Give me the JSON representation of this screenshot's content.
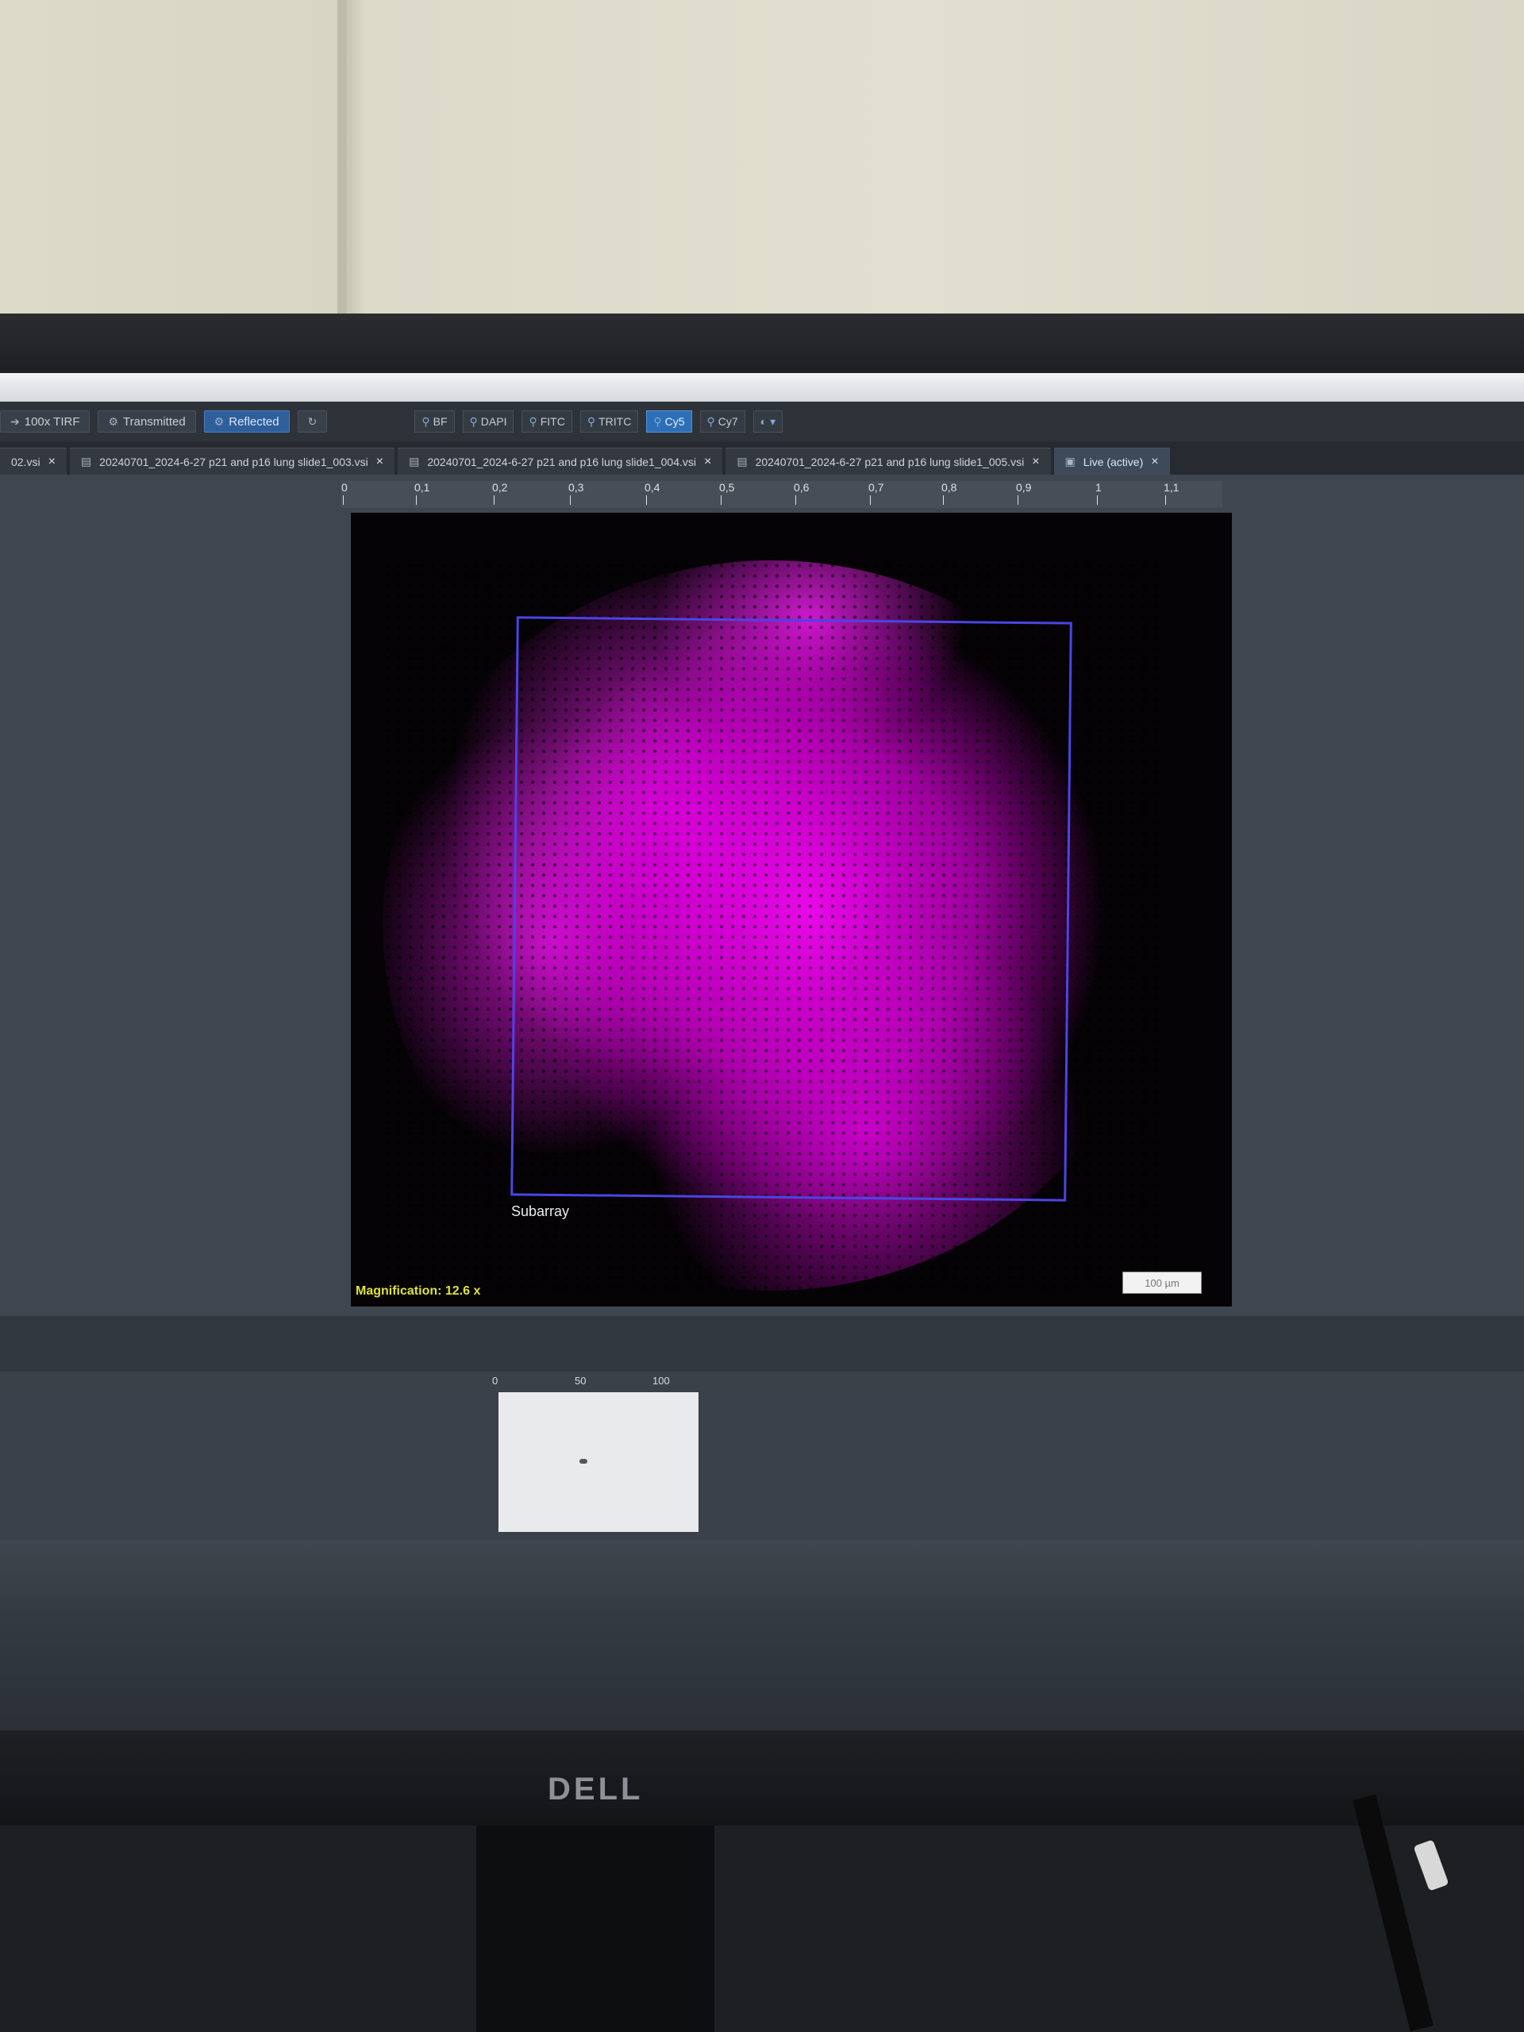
{
  "toolbar": {
    "left_buttons": [
      {
        "label": "100x TIRF",
        "icon": "arrow-icon",
        "active": false
      },
      {
        "label": "Transmitted",
        "icon": "gear-icon",
        "active": false
      },
      {
        "label": "Reflected",
        "icon": "gear-icon",
        "active": true
      }
    ],
    "channels": [
      {
        "label": "BF",
        "active": false
      },
      {
        "label": "DAPI",
        "active": false
      },
      {
        "label": "FITC",
        "active": false
      },
      {
        "label": "TRITC",
        "active": false
      },
      {
        "label": "Cy5",
        "active": true
      },
      {
        "label": "Cy7",
        "active": false
      }
    ]
  },
  "tabs": [
    {
      "label": "02.vsi"
    },
    {
      "label": "20240701_2024-6-27 p21 and p16 lung slide1_003.vsi"
    },
    {
      "label": "20240701_2024-6-27 p21 and p16 lung slide1_004.vsi"
    },
    {
      "label": "20240701_2024-6-27 p21 and p16 lung slide1_005.vsi"
    },
    {
      "label": "Live (active)"
    }
  ],
  "ruler_ticks": [
    "0",
    "0,1",
    "0,2",
    "0,3",
    "0,4",
    "0,5",
    "0,6",
    "0,7",
    "0,8",
    "0,9",
    "1",
    "1,1"
  ],
  "image": {
    "subarray_label": "Subarray",
    "scale_bar": "100 µm",
    "magnification": "Magnification:  12.6 x"
  },
  "mini_ruler_ticks": [
    "0",
    "50",
    "100"
  ],
  "monitor": {
    "brand": "DELL"
  },
  "colors": {
    "fluorescence": "#e010e0",
    "subarray": "#4a45e6",
    "magnification_text": "#dfe13a",
    "active_button": "#2f5f9b"
  }
}
